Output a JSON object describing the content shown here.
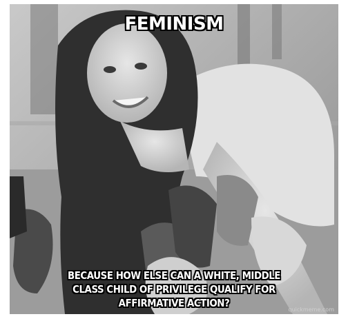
{
  "meme": {
    "top_text": "FEMINISM",
    "bottom_text": "BECAUSE HOW ELSE CAN A WHITE, MIDDLE CLASS CHILD OF PRIVILEGE QUALIFY FOR AFFIRMATIVE ACTION?",
    "watermark": "quickmeme.com"
  },
  "colors": {
    "text_fill": "#ffffff",
    "text_outline": "#000000"
  }
}
